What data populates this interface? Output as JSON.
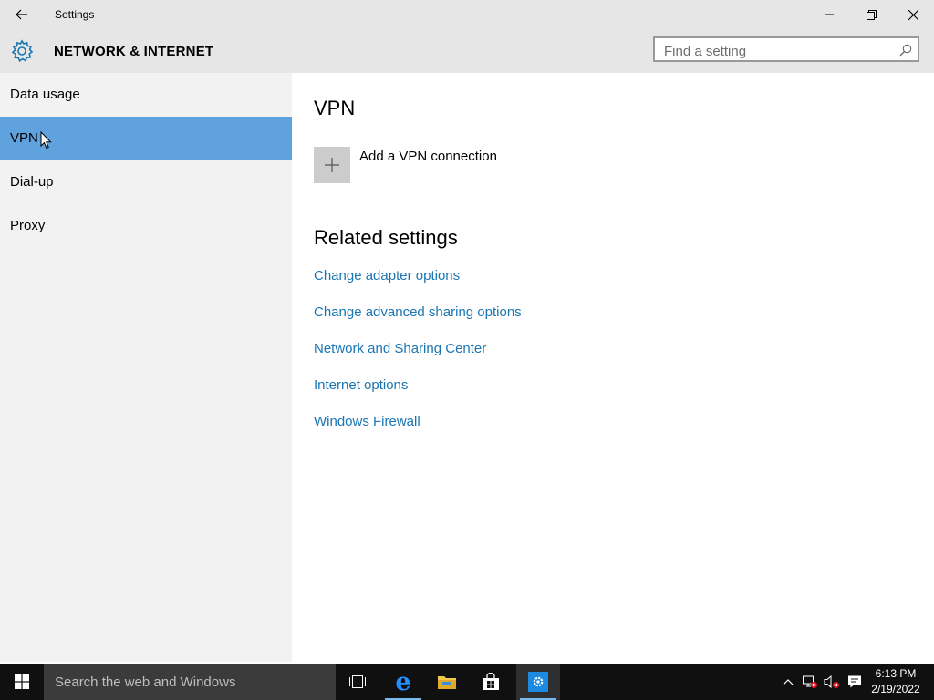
{
  "window": {
    "title": "Settings"
  },
  "header": {
    "section": "NETWORK & INTERNET",
    "search_placeholder": "Find a setting"
  },
  "sidebar": {
    "items": [
      {
        "label": "Data usage",
        "selected": false
      },
      {
        "label": "VPN",
        "selected": true
      },
      {
        "label": "Dial-up",
        "selected": false
      },
      {
        "label": "Proxy",
        "selected": false
      }
    ]
  },
  "main": {
    "heading": "VPN",
    "add_vpn_label": "Add a VPN connection",
    "related_heading": "Related settings",
    "links": [
      "Change adapter options",
      "Change advanced sharing options",
      "Network and Sharing Center",
      "Internet options",
      "Windows Firewall"
    ]
  },
  "taskbar": {
    "search_placeholder": "Search the web and Windows",
    "time": "6:13 PM",
    "date": "2/19/2022"
  },
  "colors": {
    "accent": "#5fa2dd",
    "link": "#1976b3",
    "taskbar": "#101010"
  },
  "icons": [
    "back-arrow-icon",
    "minimize-icon",
    "maximize-icon",
    "close-icon",
    "gear-icon",
    "search-icon",
    "plus-icon",
    "windows-logo-icon",
    "task-view-icon",
    "edge-icon",
    "folder-icon",
    "store-icon",
    "settings-icon",
    "chevron-up-icon",
    "network-icon",
    "volume-icon",
    "action-center-icon"
  ]
}
